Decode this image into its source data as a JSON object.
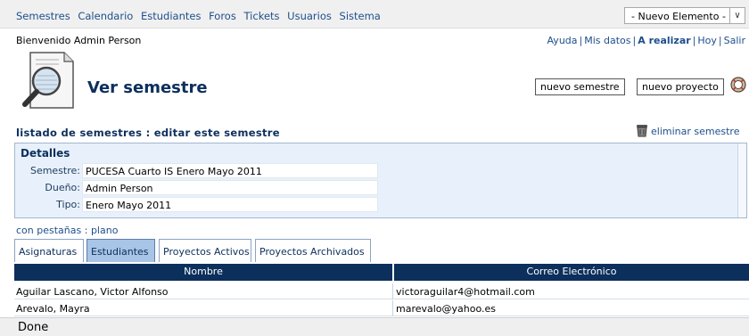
{
  "nav": {
    "items": [
      "Semestres",
      "Calendario",
      "Estudiantes",
      "Foros",
      "Tickets",
      "Usuarios",
      "Sistema"
    ],
    "new_element": "- Nuevo Elemento -"
  },
  "welcome": "Bienvenido Admin Person",
  "toplinks": {
    "help": "Ayuda",
    "my_data": "Mis datos",
    "todo": "A realizar",
    "today": "Hoy",
    "logout": "Salir"
  },
  "header": {
    "title": "Ver semestre",
    "new_semester": "nuevo semestre",
    "new_project": "nuevo proyecto"
  },
  "breadcrumb": {
    "list": "listado de semestres",
    "sep": ":",
    "edit": "editar este semestre"
  },
  "delete_semester": "eliminar semestre",
  "details": {
    "title": "Detalles",
    "rows": [
      {
        "label": "Semestre:",
        "value": "PUCESA Cuarto IS Enero Mayo 2011"
      },
      {
        "label": "Dueño:",
        "value": "Admin Person"
      },
      {
        "label": "Tipo:",
        "value": "Enero Mayo 2011"
      }
    ]
  },
  "view_mode": {
    "tabbed": "con pestañas",
    "sep": ":",
    "flat": "plano"
  },
  "tabs": [
    {
      "label": "Asignaturas",
      "active": false
    },
    {
      "label": "Estudiantes",
      "active": true
    },
    {
      "label": "Proyectos Activos",
      "active": false
    },
    {
      "label": "Proyectos Archivados",
      "active": false
    }
  ],
  "table": {
    "columns": [
      "Nombre",
      "Correo Electrónico"
    ],
    "rows": [
      [
        "Aguilar Lascano, Victor Alfonso",
        "victoraguilar4@hotmail.com"
      ],
      [
        "Arevalo, Mayra",
        "marevalo@yahoo.es"
      ]
    ]
  },
  "status": "Done",
  "colors": {
    "navy": "#0c2f5c",
    "link": "#1e4e8c",
    "details_bg": "#e8f1fb",
    "tab_active": "#a8c4e6"
  }
}
